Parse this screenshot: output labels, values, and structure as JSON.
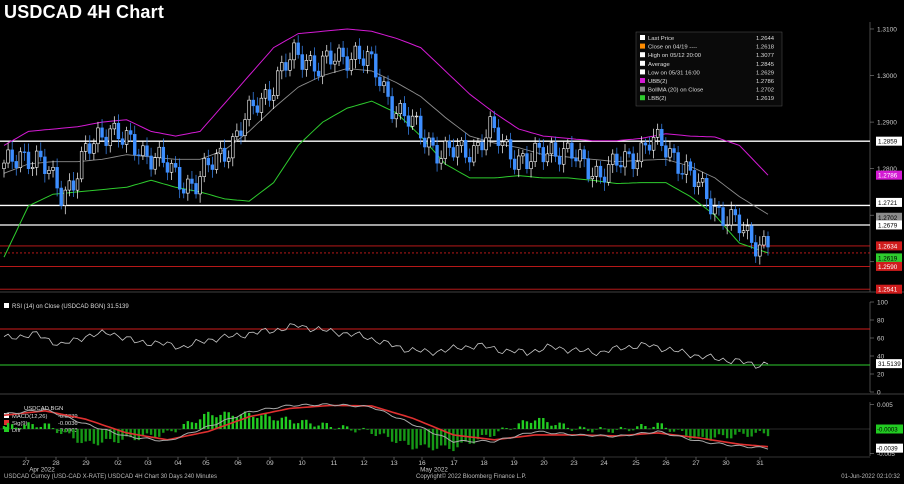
{
  "title": "USDCAD 4H Chart",
  "colors": {
    "candle_up": "#ffffff",
    "candle_down": "#3d8eff",
    "ubb": "#d41ad4",
    "lbb": "#2ecc2e",
    "average": "#8c8c8c",
    "rsi": "#c8c8c8",
    "macd": "#a8a8a8",
    "signal": "#e03030",
    "hist_up": "#22cc22",
    "hist_down": "#169916"
  },
  "legend": {
    "items": [
      {
        "label": "Last Price",
        "value": "1.2644",
        "color": "#ffffff"
      },
      {
        "label": "Close on 04/19 ----",
        "value": "1.2618",
        "color": "#ff8c00"
      },
      {
        "label": "High on 05/12 20:00",
        "value": "1.3077",
        "color": "#ffffff"
      },
      {
        "label": "Average",
        "value": "1.2845",
        "color": "#ffffff"
      },
      {
        "label": "Low on 05/31 16:00",
        "value": "1.2629",
        "color": "#ffffff"
      },
      {
        "label": "UBB(2)",
        "value": "1.2786",
        "color": "#d41ad4"
      },
      {
        "label": "BollMA (20) on Close",
        "value": "1.2702",
        "color": "#8c8c8c"
      },
      {
        "label": "LBB(2)",
        "value": "1.2619",
        "color": "#2ecc2e"
      }
    ]
  },
  "price_axis": {
    "ticks": [
      "1.3100",
      "1.3000",
      "1.2900",
      "1.2800",
      "1.2700",
      "1.2600"
    ],
    "tags": [
      {
        "text": "1.2859",
        "bg": "#ffffff",
        "fg": "#000000"
      },
      {
        "text": "1.2786",
        "bg": "#d41ad4",
        "fg": "#ffffff"
      },
      {
        "text": "1.2721",
        "bg": "#ffffff",
        "fg": "#000000"
      },
      {
        "text": "1.2702",
        "bg": "#8c8c8c",
        "fg": "#000000"
      },
      {
        "text": "1.2679",
        "bg": "#ffffff",
        "fg": "#000000"
      },
      {
        "text": "1.2634",
        "bg": "#d01c1c",
        "fg": "#ffffff"
      },
      {
        "text": "1.2619",
        "bg": "#2ecc2e",
        "fg": "#000000"
      },
      {
        "text": "1.2590",
        "bg": "#d01c1c",
        "fg": "#ffffff"
      },
      {
        "text": "1.2541",
        "bg": "#d01c1c",
        "fg": "#ffffff"
      }
    ]
  },
  "rsi_panel": {
    "label": "RSI (14) on Close (USDCAD BGN) 31.5139",
    "ticks": [
      "100",
      "80",
      "60",
      "40",
      "20",
      "0"
    ],
    "value_tag": "31.5139"
  },
  "macd_panel": {
    "title": "USDCAD BGN",
    "legend": [
      {
        "label": "MACD(12,26)",
        "value": "-0.0039",
        "color": "#ffffff"
      },
      {
        "label": "Sig(9)",
        "value": "-0.0036",
        "color": "#e03030"
      },
      {
        "label": "Diff",
        "value": "-0.0003",
        "color": "#22cc22"
      }
    ],
    "ticks": [
      "0.005",
      "-0.005"
    ],
    "tags": [
      {
        "text": "-0.0003",
        "bg": "#22cc22",
        "fg": "#000000"
      },
      {
        "text": "-0.0039",
        "bg": "#ffffff",
        "fg": "#000000"
      }
    ]
  },
  "x_axis": {
    "labels": [
      "27",
      "28",
      "29",
      "02",
      "03",
      "04",
      "05",
      "06",
      "09",
      "10",
      "11",
      "12",
      "13",
      "16",
      "17",
      "18",
      "19",
      "20",
      "23",
      "24",
      "25",
      "26",
      "27",
      "30",
      "31"
    ],
    "months": [
      "Apr 2022",
      "May 2022"
    ]
  },
  "footer": {
    "left": "USDCAD Curncy (USD-CAD X-RATE) USDCAD 4H Chart 30 Days 240 Minutes",
    "center": "Copyright© 2022 Bloomberg Finance L.P.",
    "right": "01-Jun-2022 02:10:32"
  },
  "chart_data": {
    "type": "candlestick",
    "timeframe": "4H",
    "ylim": [
      1.2535,
      1.3115
    ],
    "horizontal_levels": [
      1.2859,
      1.2721,
      1.2679,
      1.2634,
      1.2619,
      1.259,
      1.2541
    ],
    "days": [
      "27",
      "28",
      "29",
      "02",
      "03",
      "04",
      "05",
      "06",
      "09",
      "10",
      "11",
      "12",
      "13",
      "16",
      "17",
      "18",
      "19",
      "20",
      "23",
      "24",
      "25",
      "26",
      "27",
      "30",
      "31"
    ],
    "close_path": [
      [
        0,
        1.28
      ],
      [
        4,
        1.2835
      ],
      [
        8,
        1.2815
      ],
      [
        11,
        1.279
      ],
      [
        14,
        1.2752
      ],
      [
        17,
        1.277
      ],
      [
        20,
        1.283
      ],
      [
        23,
        1.287
      ],
      [
        26,
        1.289
      ],
      [
        29,
        1.286
      ],
      [
        32,
        1.2845
      ],
      [
        35,
        1.2835
      ],
      [
        38,
        1.282
      ],
      [
        41,
        1.279
      ],
      [
        44,
        1.277
      ],
      [
        47,
        1.277
      ],
      [
        50,
        1.28
      ],
      [
        53,
        1.283
      ],
      [
        56,
        1.286
      ],
      [
        59,
        1.29
      ],
      [
        62,
        1.294
      ],
      [
        65,
        1.297
      ],
      [
        68,
        1.301
      ],
      [
        71,
        1.304
      ],
      [
        74,
        1.304
      ],
      [
        77,
        1.302
      ],
      [
        80,
        1.303
      ],
      [
        83,
        1.304
      ],
      [
        86,
        1.305
      ],
      [
        89,
        1.303
      ],
      [
        92,
        1.299
      ],
      [
        95,
        1.294
      ],
      [
        98,
        1.291
      ],
      [
        101,
        1.2885
      ],
      [
        104,
        1.286
      ],
      [
        107,
        1.283
      ],
      [
        110,
        1.2835
      ],
      [
        113,
        1.284
      ],
      [
        116,
        1.285
      ],
      [
        119,
        1.288
      ],
      [
        122,
        1.2855
      ],
      [
        125,
        1.283
      ],
      [
        128,
        1.281
      ],
      [
        131,
        1.283
      ],
      [
        134,
        1.2845
      ],
      [
        137,
        1.2835
      ],
      [
        140,
        1.282
      ],
      [
        143,
        1.2805
      ],
      [
        146,
        1.279
      ],
      [
        149,
        1.28
      ],
      [
        152,
        1.282
      ],
      [
        155,
        1.2835
      ],
      [
        158,
        1.2855
      ],
      [
        161,
        1.285
      ],
      [
        164,
        1.283
      ],
      [
        167,
        1.2795
      ],
      [
        170,
        1.276
      ],
      [
        173,
        1.273
      ],
      [
        176,
        1.27
      ],
      [
        179,
        1.268
      ],
      [
        182,
        1.2655
      ],
      [
        185,
        1.264
      ],
      [
        187,
        1.2644
      ]
    ],
    "bollinger": {
      "upper": [
        [
          0,
          1.285
        ],
        [
          6,
          1.288
        ],
        [
          12,
          1.2885
        ],
        [
          18,
          1.289
        ],
        [
          24,
          1.29
        ],
        [
          30,
          1.2905
        ],
        [
          36,
          1.288
        ],
        [
          42,
          1.287
        ],
        [
          48,
          1.288
        ],
        [
          54,
          1.294
        ],
        [
          60,
          1.3
        ],
        [
          66,
          1.306
        ],
        [
          72,
          1.309
        ],
        [
          78,
          1.3095
        ],
        [
          84,
          1.31
        ],
        [
          90,
          1.3095
        ],
        [
          96,
          1.308
        ],
        [
          102,
          1.306
        ],
        [
          108,
          1.301
        ],
        [
          114,
          1.296
        ],
        [
          120,
          1.292
        ],
        [
          126,
          1.2885
        ],
        [
          132,
          1.287
        ],
        [
          138,
          1.2865
        ],
        [
          144,
          1.286
        ],
        [
          150,
          1.286
        ],
        [
          156,
          1.2865
        ],
        [
          162,
          1.2875
        ],
        [
          168,
          1.287
        ],
        [
          174,
          1.2868
        ],
        [
          180,
          1.285
        ],
        [
          187,
          1.2786
        ]
      ],
      "middle": [
        [
          0,
          1.279
        ],
        [
          6,
          1.281
        ],
        [
          12,
          1.2815
        ],
        [
          18,
          1.2815
        ],
        [
          24,
          1.282
        ],
        [
          30,
          1.283
        ],
        [
          36,
          1.2825
        ],
        [
          42,
          1.282
        ],
        [
          48,
          1.282
        ],
        [
          54,
          1.284
        ],
        [
          60,
          1.288
        ],
        [
          66,
          1.293
        ],
        [
          72,
          1.2975
        ],
        [
          78,
          1.3
        ],
        [
          84,
          1.3015
        ],
        [
          90,
          1.301
        ],
        [
          96,
          1.2985
        ],
        [
          102,
          1.2955
        ],
        [
          108,
          1.291
        ],
        [
          114,
          1.287
        ],
        [
          120,
          1.2855
        ],
        [
          126,
          1.2845
        ],
        [
          132,
          1.283
        ],
        [
          138,
          1.2825
        ],
        [
          144,
          1.282
        ],
        [
          150,
          1.2815
        ],
        [
          156,
          1.2818
        ],
        [
          162,
          1.282
        ],
        [
          168,
          1.2805
        ],
        [
          174,
          1.278
        ],
        [
          180,
          1.274
        ],
        [
          187,
          1.2702
        ]
      ],
      "lower": [
        [
          0,
          1.261
        ],
        [
          6,
          1.272
        ],
        [
          12,
          1.2745
        ],
        [
          18,
          1.275
        ],
        [
          24,
          1.2755
        ],
        [
          30,
          1.276
        ],
        [
          36,
          1.2775
        ],
        [
          42,
          1.276
        ],
        [
          48,
          1.275
        ],
        [
          54,
          1.2735
        ],
        [
          60,
          1.273
        ],
        [
          66,
          1.277
        ],
        [
          72,
          1.285
        ],
        [
          78,
          1.29
        ],
        [
          84,
          1.293
        ],
        [
          90,
          1.2945
        ],
        [
          96,
          1.292
        ],
        [
          102,
          1.287
        ],
        [
          108,
          1.281
        ],
        [
          114,
          1.278
        ],
        [
          120,
          1.278
        ],
        [
          126,
          1.2785
        ],
        [
          132,
          1.278
        ],
        [
          138,
          1.278
        ],
        [
          144,
          1.2775
        ],
        [
          150,
          1.2768
        ],
        [
          156,
          1.277
        ],
        [
          162,
          1.277
        ],
        [
          168,
          1.274
        ],
        [
          174,
          1.27
        ],
        [
          180,
          1.264
        ],
        [
          187,
          1.2619
        ]
      ]
    },
    "rsi": {
      "ylim": [
        0,
        100
      ],
      "overbought": 70,
      "oversold": 30,
      "last": 31.5139,
      "points": [
        [
          0,
          60
        ],
        [
          8,
          64
        ],
        [
          14,
          52
        ],
        [
          20,
          62
        ],
        [
          26,
          66
        ],
        [
          32,
          56
        ],
        [
          38,
          54
        ],
        [
          44,
          50
        ],
        [
          50,
          58
        ],
        [
          56,
          62
        ],
        [
          62,
          66
        ],
        [
          68,
          70
        ],
        [
          72,
          74
        ],
        [
          76,
          70
        ],
        [
          82,
          66
        ],
        [
          88,
          62
        ],
        [
          92,
          56
        ],
        [
          98,
          48
        ],
        [
          104,
          44
        ],
        [
          110,
          48
        ],
        [
          116,
          52
        ],
        [
          122,
          46
        ],
        [
          128,
          44
        ],
        [
          134,
          50
        ],
        [
          140,
          46
        ],
        [
          146,
          44
        ],
        [
          152,
          50
        ],
        [
          158,
          52
        ],
        [
          164,
          46
        ],
        [
          170,
          40
        ],
        [
          176,
          36
        ],
        [
          180,
          34
        ],
        [
          184,
          30
        ],
        [
          187,
          31.5
        ]
      ]
    },
    "macd": {
      "ylim": [
        -0.0055,
        0.0055
      ],
      "macd": [
        [
          0,
          0.003
        ],
        [
          10,
          0.004
        ],
        [
          20,
          0.001
        ],
        [
          30,
          -0.0015
        ],
        [
          40,
          -0.0025
        ],
        [
          50,
          0.0005
        ],
        [
          60,
          0.0035
        ],
        [
          70,
          0.0048
        ],
        [
          80,
          0.005
        ],
        [
          90,
          0.0045
        ],
        [
          100,
          0.001
        ],
        [
          110,
          -0.0025
        ],
        [
          120,
          -0.0025
        ],
        [
          130,
          -0.0005
        ],
        [
          140,
          -0.0012
        ],
        [
          150,
          -0.0015
        ],
        [
          160,
          -0.0005
        ],
        [
          170,
          -0.0025
        ],
        [
          180,
          -0.0035
        ],
        [
          187,
          -0.0039
        ]
      ],
      "signal": [
        [
          0,
          0.0028
        ],
        [
          10,
          0.0037
        ],
        [
          20,
          0.002
        ],
        [
          30,
          -0.0008
        ],
        [
          40,
          -0.0022
        ],
        [
          50,
          -0.0005
        ],
        [
          60,
          0.0025
        ],
        [
          70,
          0.0042
        ],
        [
          80,
          0.0048
        ],
        [
          90,
          0.0047
        ],
        [
          100,
          0.0022
        ],
        [
          110,
          -0.0012
        ],
        [
          120,
          -0.0022
        ],
        [
          130,
          -0.0012
        ],
        [
          140,
          -0.0012
        ],
        [
          150,
          -0.0014
        ],
        [
          160,
          -0.0008
        ],
        [
          170,
          -0.0018
        ],
        [
          180,
          -0.0031
        ],
        [
          187,
          -0.0036
        ]
      ],
      "diff_last": -0.0003
    }
  }
}
